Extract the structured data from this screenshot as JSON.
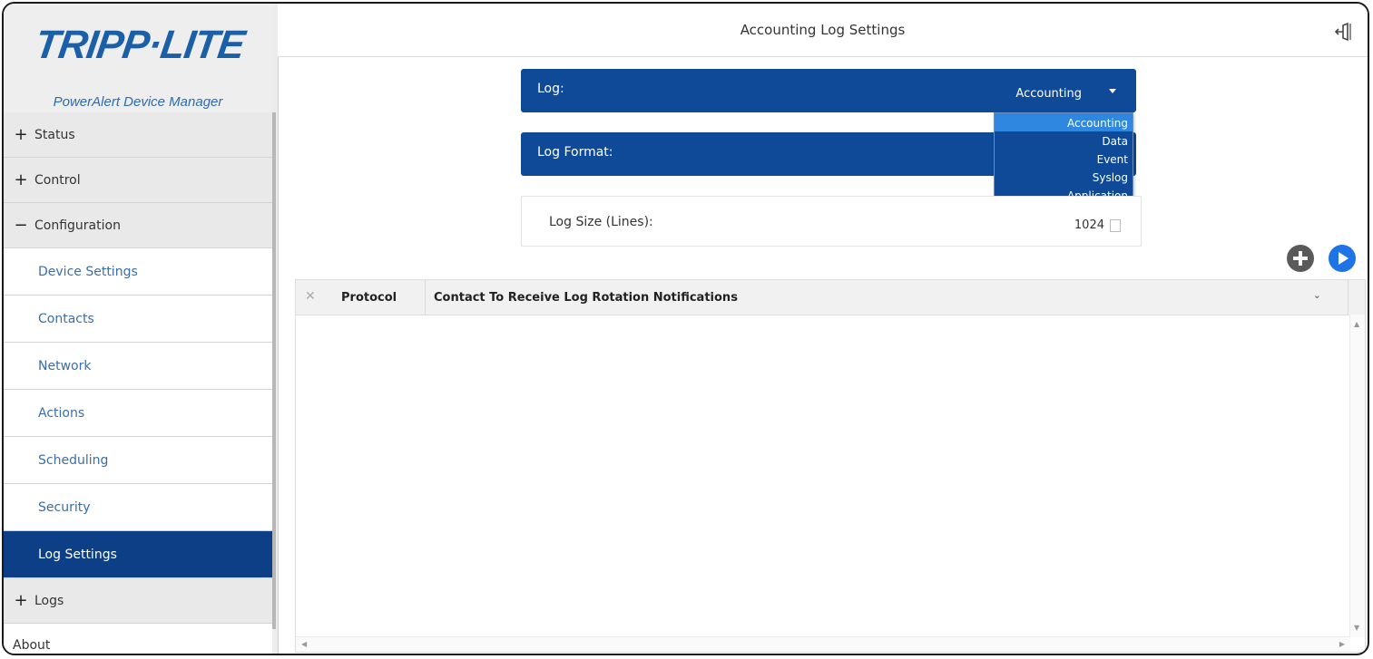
{
  "brand": {
    "logo_text": "TRIPP·LITE",
    "subtitle": "PowerAlert Device Manager"
  },
  "sidebar": {
    "sections": [
      {
        "sign": "+",
        "label": "Status"
      },
      {
        "sign": "+",
        "label": "Control"
      },
      {
        "sign": "−",
        "label": "Configuration"
      }
    ],
    "sub_items": [
      {
        "label": "Device Settings"
      },
      {
        "label": "Contacts"
      },
      {
        "label": "Network"
      },
      {
        "label": "Actions"
      },
      {
        "label": "Scheduling"
      },
      {
        "label": "Security"
      },
      {
        "label": "Log Settings",
        "active": true
      }
    ],
    "logs": {
      "sign": "+",
      "label": "Logs"
    },
    "about": "About"
  },
  "header": {
    "title": "Accounting Log Settings",
    "exit_icon": "exit-icon"
  },
  "log_select": {
    "label": "Log:",
    "value": "Accounting",
    "options": [
      "Accounting",
      "Data",
      "Event",
      "Syslog",
      "Application"
    ],
    "selected_index": 0
  },
  "log_format": {
    "label": "Log Format:"
  },
  "log_size": {
    "label": "Log Size (Lines):",
    "value": "1024"
  },
  "actions": {
    "add_icon": "plus-circle-icon",
    "next_icon": "play-circle-icon"
  },
  "grid": {
    "columns": [
      "Protocol",
      "Contact To Receive Log Rotation Notifications"
    ],
    "rows": []
  },
  "colors": {
    "accent": "#0e4a97",
    "active_nav": "#0d3f86",
    "dropdown_selected": "#2f87e0",
    "play_button": "#1e74e6"
  }
}
